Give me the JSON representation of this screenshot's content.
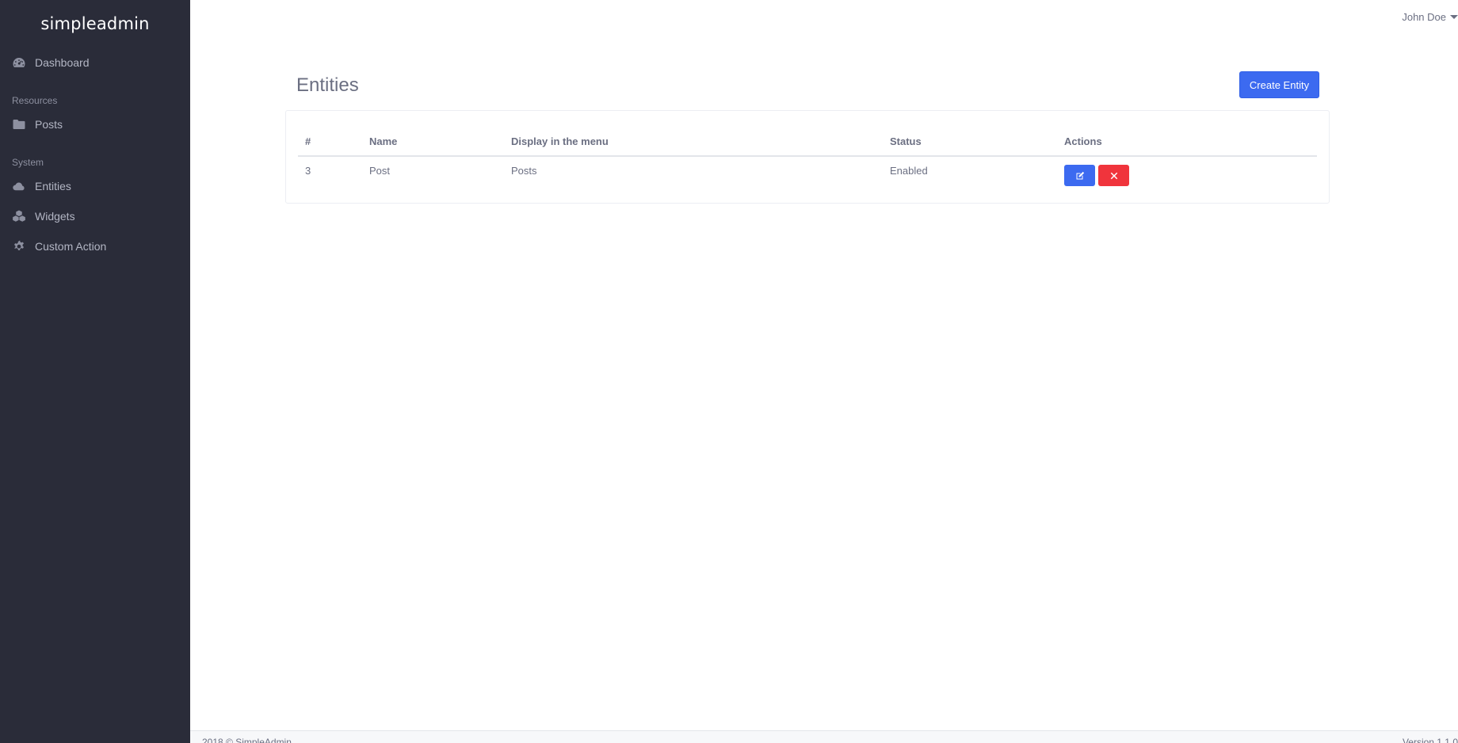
{
  "brand": "simpleadmin",
  "sidebar": {
    "items": [
      {
        "label": "Dashboard",
        "icon": "dashboard-icon"
      },
      {
        "label": "Posts",
        "icon": "folder-icon"
      },
      {
        "label": "Entities",
        "icon": "cloud-icon"
      },
      {
        "label": "Widgets",
        "icon": "cubes-icon"
      },
      {
        "label": "Custom Action",
        "icon": "gear-icon"
      }
    ],
    "headers": [
      "Resources",
      "System"
    ]
  },
  "user": {
    "name": "John Doe"
  },
  "main": {
    "title": "Entities",
    "create_label": "Create Entity",
    "table": {
      "columns": [
        "#",
        "Name",
        "Display in the menu",
        "Status",
        "Actions"
      ],
      "rows": [
        {
          "id": "3",
          "name": "Post",
          "menu": "Posts",
          "status": "Enabled"
        }
      ]
    }
  },
  "footer": {
    "copyright": "2018 © SimpleAdmin",
    "version": "Version 1.1.0"
  },
  "colors": {
    "sidebar_bg": "#2a2c39",
    "primary": "#3c6af0",
    "danger": "#f0343c"
  }
}
